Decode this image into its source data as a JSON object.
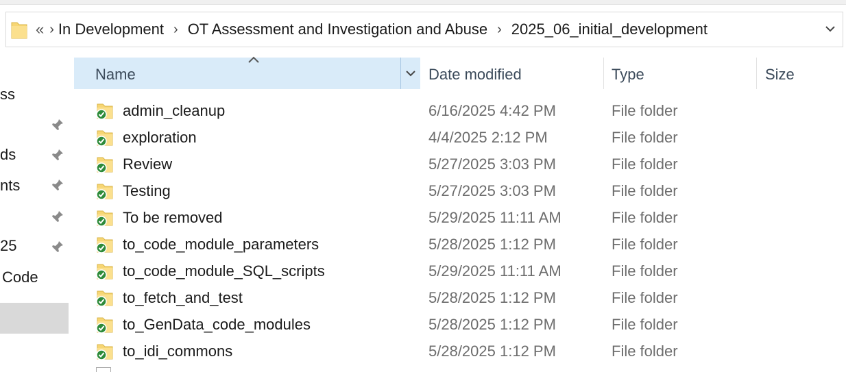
{
  "breadcrumb": {
    "overflow": "«",
    "items": [
      "In Development",
      "OT Assessment and Investigation and Abuse",
      "2025_06_initial_development"
    ],
    "separator": ">"
  },
  "nav": {
    "items": [
      {
        "label": "ss",
        "pinned": false
      },
      {
        "label": "",
        "pinned": true
      },
      {
        "label": "ds",
        "pinned": true
      },
      {
        "label": "nts",
        "pinned": true
      },
      {
        "label": "",
        "pinned": true
      },
      {
        "label": "25",
        "pinned": true
      },
      {
        "label": "Code",
        "pinned": false
      }
    ]
  },
  "columns": {
    "name": "Name",
    "date_modified": "Date modified",
    "type": "Type",
    "size": "Size"
  },
  "files": [
    {
      "name": "admin_cleanup",
      "date": "6/16/2025 4:42 PM",
      "type": "File folder"
    },
    {
      "name": "exploration",
      "date": "4/4/2025 2:12 PM",
      "type": "File folder"
    },
    {
      "name": "Review",
      "date": "5/27/2025 3:03 PM",
      "type": "File folder"
    },
    {
      "name": "Testing",
      "date": "5/27/2025 3:03 PM",
      "type": "File folder"
    },
    {
      "name": "To be removed",
      "date": "5/29/2025 11:11 AM",
      "type": "File folder"
    },
    {
      "name": "to_code_module_parameters",
      "date": "5/28/2025 1:12 PM",
      "type": "File folder"
    },
    {
      "name": "to_code_module_SQL_scripts",
      "date": "5/29/2025 11:11 AM",
      "type": "File folder"
    },
    {
      "name": "to_fetch_and_test",
      "date": "5/28/2025 1:12 PM",
      "type": "File folder"
    },
    {
      "name": "to_GenData_code_modules",
      "date": "5/28/2025 1:12 PM",
      "type": "File folder"
    },
    {
      "name": "to_idi_commons",
      "date": "5/28/2025 1:12 PM",
      "type": "File folder"
    }
  ],
  "colors": {
    "folder_yellow": "#f7d674",
    "sync_green": "#2e8b3a",
    "header_selected": "#d9ebf9"
  },
  "icons": {
    "row": "folder-synced-icon",
    "pin": "pin-icon",
    "sort": "sort-ascending-icon"
  }
}
